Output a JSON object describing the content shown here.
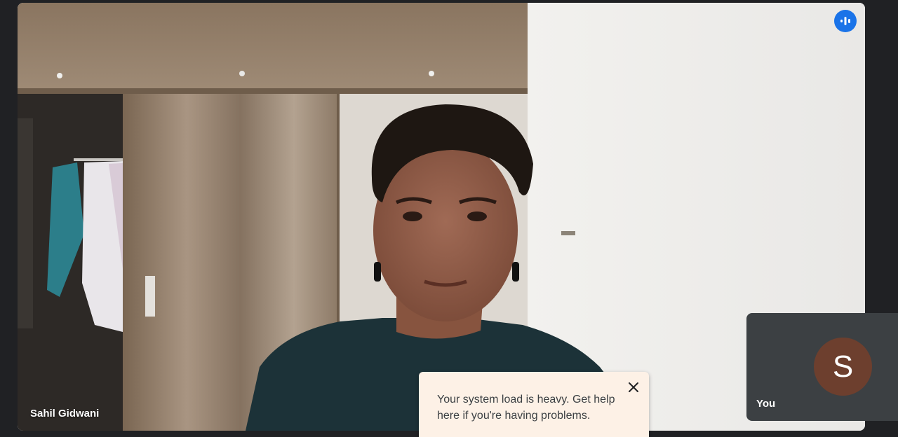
{
  "main_participant": {
    "name": "Sahil Gidwani"
  },
  "self_tile": {
    "label": "You",
    "avatar_initial": "S",
    "avatar_color": "#6d3f2e"
  },
  "notification": {
    "message": "Your system load is heavy. Get help here if you're having problems."
  },
  "icons": {
    "speaking": "audio-level-icon",
    "close": "close-icon"
  },
  "colors": {
    "background": "#202124",
    "accent": "#1a73e8",
    "toast_background": "#fdf1e6"
  }
}
